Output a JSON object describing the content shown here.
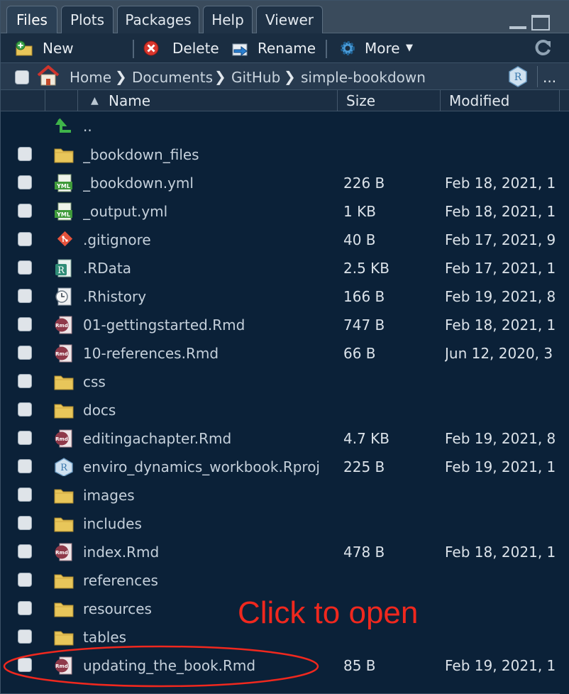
{
  "tabs": [
    {
      "label": "Files",
      "active": true
    },
    {
      "label": "Plots",
      "active": false
    },
    {
      "label": "Packages",
      "active": false
    },
    {
      "label": "Help",
      "active": false
    },
    {
      "label": "Viewer",
      "active": false
    }
  ],
  "toolbar": {
    "new_folder": "New Folder",
    "delete": "Delete",
    "rename": "Rename",
    "more": "More"
  },
  "breadcrumb": {
    "items": [
      "Home",
      "Documents",
      "GitHub",
      "simple-bookdown"
    ],
    "overflow": "..."
  },
  "columns": {
    "name": "Name",
    "size": "Size",
    "modified": "Modified"
  },
  "parent_dir": "..",
  "files": [
    {
      "name": "_bookdown_files",
      "size": "",
      "modified": "",
      "icon": "folder-icon"
    },
    {
      "name": "_bookdown.yml",
      "size": "226 B",
      "modified": "Feb 18, 2021, 1",
      "icon": "yml-file-icon"
    },
    {
      "name": "_output.yml",
      "size": "1 KB",
      "modified": "Feb 18, 2021, 1",
      "icon": "yml-file-icon"
    },
    {
      "name": ".gitignore",
      "size": "40 B",
      "modified": "Feb 17, 2021, 9",
      "icon": "git-file-icon"
    },
    {
      "name": ".RData",
      "size": "2.5 KB",
      "modified": "Feb 17, 2021, 1",
      "icon": "rdata-file-icon"
    },
    {
      "name": ".Rhistory",
      "size": "166 B",
      "modified": "Feb 19, 2021, 8",
      "icon": "history-file-icon"
    },
    {
      "name": "01-gettingstarted.Rmd",
      "size": "747 B",
      "modified": "Feb 18, 2021, 1",
      "icon": "rmd-file-icon"
    },
    {
      "name": "10-references.Rmd",
      "size": "66 B",
      "modified": "Jun 12, 2020, 3",
      "icon": "rmd-file-icon"
    },
    {
      "name": "css",
      "size": "",
      "modified": "",
      "icon": "folder-icon"
    },
    {
      "name": "docs",
      "size": "",
      "modified": "",
      "icon": "folder-icon"
    },
    {
      "name": "editingachapter.Rmd",
      "size": "4.7 KB",
      "modified": "Feb 19, 2021, 8",
      "icon": "rmd-file-icon"
    },
    {
      "name": "enviro_dynamics_workbook.Rproj",
      "size": "225 B",
      "modified": "Feb 19, 2021, 1",
      "icon": "rproj-file-icon"
    },
    {
      "name": "images",
      "size": "",
      "modified": "",
      "icon": "folder-icon"
    },
    {
      "name": "includes",
      "size": "",
      "modified": "",
      "icon": "folder-icon"
    },
    {
      "name": "index.Rmd",
      "size": "478 B",
      "modified": "Feb 18, 2021, 1",
      "icon": "rmd-file-icon"
    },
    {
      "name": "references",
      "size": "",
      "modified": "",
      "icon": "folder-icon"
    },
    {
      "name": "resources",
      "size": "",
      "modified": "",
      "icon": "folder-icon"
    },
    {
      "name": "tables",
      "size": "",
      "modified": "",
      "icon": "folder-icon"
    },
    {
      "name": "updating_the_book.Rmd",
      "size": "85 B",
      "modified": "Feb 19, 2021, 1",
      "icon": "rmd-file-icon"
    }
  ],
  "annotation": {
    "text": "Click to open",
    "color": "#f0281e"
  },
  "colors": {
    "background": "#0b2138",
    "folder": "#e8c65a",
    "rmd": "#8f3a4a"
  }
}
